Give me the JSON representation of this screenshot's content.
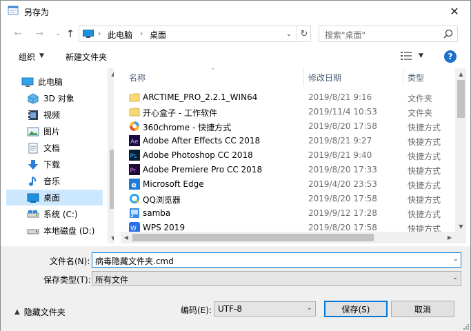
{
  "window": {
    "title": "另存为",
    "close_glyph": "✕"
  },
  "address": {
    "back_glyph": "←",
    "forward_glyph": "→",
    "recent_glyph": "⌄",
    "up_glyph": "↑",
    "crumbs": [
      "此电脑",
      "桌面"
    ],
    "sep_glyph": "›",
    "dropdown_glyph": "⌄",
    "refresh_glyph": "↻"
  },
  "search": {
    "placeholder": "搜索\"桌面\""
  },
  "toolbar": {
    "organize_label": "组织",
    "caret_glyph": "▼",
    "new_folder_label": "新建文件夹",
    "help_glyph": "?"
  },
  "nav_pane": {
    "items": [
      {
        "label": "此电脑",
        "icon": "computer-icon",
        "selected": false
      },
      {
        "label": "3D 对象",
        "icon": "3d-objects-icon",
        "selected": false
      },
      {
        "label": "视频",
        "icon": "video-icon",
        "selected": false
      },
      {
        "label": "图片",
        "icon": "pictures-icon",
        "selected": false
      },
      {
        "label": "文档",
        "icon": "documents-icon",
        "selected": false
      },
      {
        "label": "下载",
        "icon": "download-icon",
        "selected": false
      },
      {
        "label": "音乐",
        "icon": "music-icon",
        "selected": false
      },
      {
        "label": "桌面",
        "icon": "desktop-icon",
        "selected": true
      },
      {
        "label": "系统 (C:)",
        "icon": "drive-c-icon",
        "selected": false
      },
      {
        "label": "本地磁盘 (D:)",
        "icon": "drive-d-icon",
        "selected": false
      }
    ],
    "scroll_up_glyph": "▲",
    "scroll_down_glyph": "▼"
  },
  "file_list": {
    "columns": {
      "name": "名称",
      "date": "修改日期",
      "type": "类型"
    },
    "sort_glyph": "⌃",
    "rows": [
      {
        "name": "ARCTIME_PRO_2.2.1_WIN64",
        "date": "2019/8/21 9:16",
        "type": "文件夹",
        "icon": "folder-icon"
      },
      {
        "name": "开心盒子 - 工作软件",
        "date": "2019/11/4 10:53",
        "type": "文件夹",
        "icon": "folder-icon"
      },
      {
        "name": "360chrome - 快捷方式",
        "date": "2019/8/20 17:58",
        "type": "快捷方式",
        "icon": "360chrome-icon"
      },
      {
        "name": "Adobe After Effects CC 2018",
        "date": "2019/8/21 9:27",
        "type": "快捷方式",
        "icon": "after-effects-icon"
      },
      {
        "name": "Adobe Photoshop CC 2018",
        "date": "2019/8/21 9:40",
        "type": "快捷方式",
        "icon": "photoshop-icon"
      },
      {
        "name": "Adobe Premiere Pro CC 2018",
        "date": "2019/8/20 17:33",
        "type": "快捷方式",
        "icon": "premiere-icon"
      },
      {
        "name": "Microsoft Edge",
        "date": "2019/4/20 23:53",
        "type": "快捷方式",
        "icon": "edge-icon"
      },
      {
        "name": "QQ浏览器",
        "date": "2019/8/20 17:58",
        "type": "快捷方式",
        "icon": "qq-browser-icon"
      },
      {
        "name": "samba",
        "date": "2019/9/12 17:28",
        "type": "快捷方式",
        "icon": "shortcut-icon"
      },
      {
        "name": "WPS 2019",
        "date": "2019/8/20 17:58",
        "type": "快捷方式",
        "icon": "wps-icon"
      }
    ],
    "scroll_up_glyph": "▲",
    "scroll_down_glyph": "▼",
    "scroll_left_glyph": "◀",
    "scroll_right_glyph": "▶"
  },
  "form": {
    "filename_label": "文件名(N):",
    "filename_value": "病毒隐藏文件夹.cmd",
    "filetype_label": "保存类型(T):",
    "filetype_value": "所有文件",
    "dropdown_glyph": "⌄",
    "hide_folders_label": "隐藏文件夹",
    "hide_folders_glyph": "▲",
    "encoding_label": "编码(E):",
    "encoding_value": "UTF-8",
    "save_label": "保存(S)",
    "cancel_label": "取消"
  },
  "colors": {
    "accent": "#0078d7",
    "selected_bg": "#cce8ff",
    "folder": "#f8d775"
  }
}
